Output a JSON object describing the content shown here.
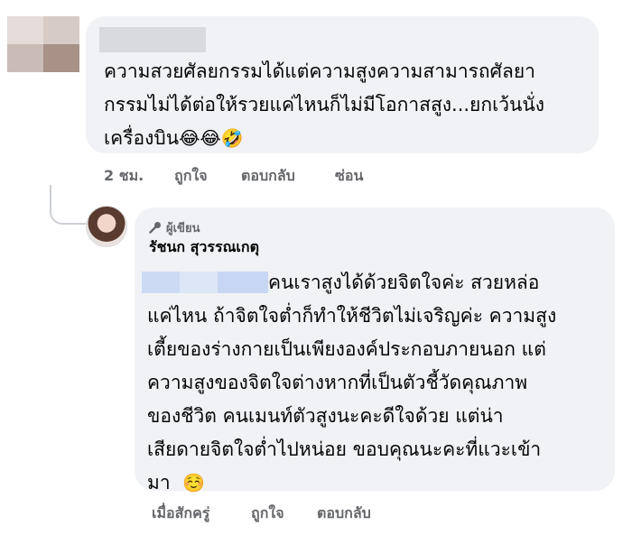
{
  "comment": {
    "text_lines": [
      "ความสวยศัลยกรรมได้แต่ความสูงความสามารถศัลยา",
      "กรรมไม่ได้ต่อให้รวยแค่ไหนก็ไม่มีโอกาสสูง...ยกเว้นนั่ง",
      "เครื่องบิน"
    ],
    "emojis": "😂😂🤣",
    "time": "2 ชม.",
    "like": "ถูกใจ",
    "reply": "ตอบกลับ",
    "hide": "ซ่อน"
  },
  "reply": {
    "badge": "ผู้เขียน",
    "author": "รัชนก สุวรรณเกตุ",
    "text_lines": [
      "คนเราสูงได้ด้วยจิตใจค่ะ สวยหล่อ",
      "แค่ไหน ถ้าจิตใจต่ำก็ทำให้ชีวิตไม่เจริญค่ะ ความสูง",
      "เตี้ยของร่างกายเป็นเพียงองค์ประกอบภายนอก แต่",
      "ความสูงของจิตใจต่างหากที่เป็นตัวชี้วัดคุณภาพ",
      "ของชีวิต คนเมนท์ตัวสูงนะคะดีใจด้วย แต่น่า",
      "เสียดายจิตใจต่ำไปหน่อย ขอบคุณนะคะที่แวะเข้า",
      "มา"
    ],
    "emoji": "☺️",
    "time": "เมื่อสักครู่",
    "like": "ถูกใจ",
    "reply": "ตอบกลับ"
  }
}
